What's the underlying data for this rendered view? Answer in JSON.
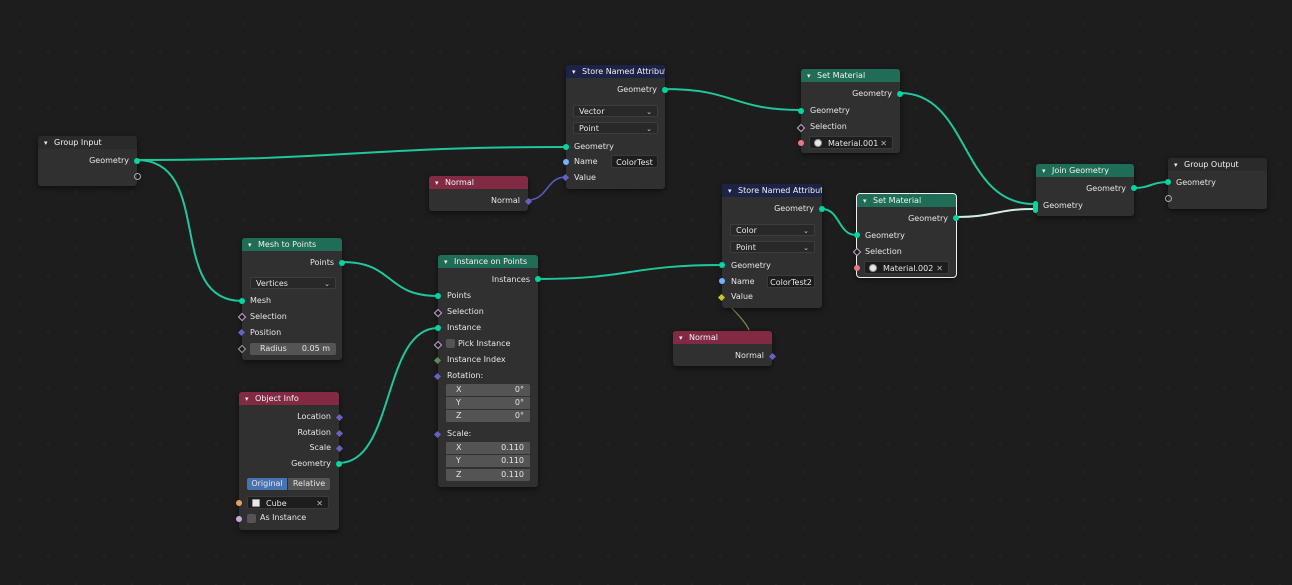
{
  "nodes": {
    "group_input": {
      "title": "Group Input",
      "out_geometry": "Geometry"
    },
    "mesh_to_points": {
      "title": "Mesh to Points",
      "out_points": "Points",
      "mode": "Vertices",
      "in_mesh": "Mesh",
      "in_selection": "Selection",
      "in_position": "Position",
      "radius_label": "Radius",
      "radius_value": "0.05 m"
    },
    "object_info": {
      "title": "Object Info",
      "out_location": "Location",
      "out_rotation": "Rotation",
      "out_scale": "Scale",
      "out_geometry": "Geometry",
      "btn_original": "Original",
      "btn_relative": "Relative",
      "object_value": "Cube",
      "as_instance": "As Instance"
    },
    "normal_1": {
      "title": "Normal",
      "out_normal": "Normal"
    },
    "normal_2": {
      "title": "Normal",
      "out_normal": "Normal"
    },
    "store_1": {
      "title": "Store Named Attribute",
      "out_geometry": "Geometry",
      "data_type": "Vector",
      "domain": "Point",
      "in_geometry": "Geometry",
      "name_label": "Name",
      "name_value": "ColorTest",
      "in_value": "Value"
    },
    "store_2": {
      "title": "Store Named Attribute",
      "out_geometry": "Geometry",
      "data_type": "Color",
      "domain": "Point",
      "in_geometry": "Geometry",
      "name_label": "Name",
      "name_value": "ColorTest2",
      "in_value": "Value"
    },
    "instance_on_points": {
      "title": "Instance on Points",
      "out_instances": "Instances",
      "in_points": "Points",
      "in_selection": "Selection",
      "in_instance": "Instance",
      "pick_instance": "Pick Instance",
      "in_instance_index": "Instance Index",
      "rotation_label": "Rotation:",
      "rot_x": "X",
      "rot_x_val": "0°",
      "rot_y": "Y",
      "rot_y_val": "0°",
      "rot_z": "Z",
      "rot_z_val": "0°",
      "scale_label": "Scale:",
      "sc_x": "X",
      "sc_x_val": "0.110",
      "sc_y": "Y",
      "sc_y_val": "0.110",
      "sc_z": "Z",
      "sc_z_val": "0.110"
    },
    "set_material_1": {
      "title": "Set Material",
      "out_geometry": "Geometry",
      "in_geometry": "Geometry",
      "in_selection": "Selection",
      "material": "Material.001"
    },
    "set_material_2": {
      "title": "Set Material",
      "out_geometry": "Geometry",
      "in_geometry": "Geometry",
      "in_selection": "Selection",
      "material": "Material.002"
    },
    "join_geometry": {
      "title": "Join Geometry",
      "out_geometry": "Geometry",
      "in_geometry": "Geometry"
    },
    "group_output": {
      "title": "Group Output",
      "in_geometry": "Geometry"
    }
  },
  "colors": {
    "geometry_link": "#00d6a3",
    "vector_link": "#6363c7",
    "color_link": "#c7c729",
    "selected_outline": "#f0f0f0"
  }
}
